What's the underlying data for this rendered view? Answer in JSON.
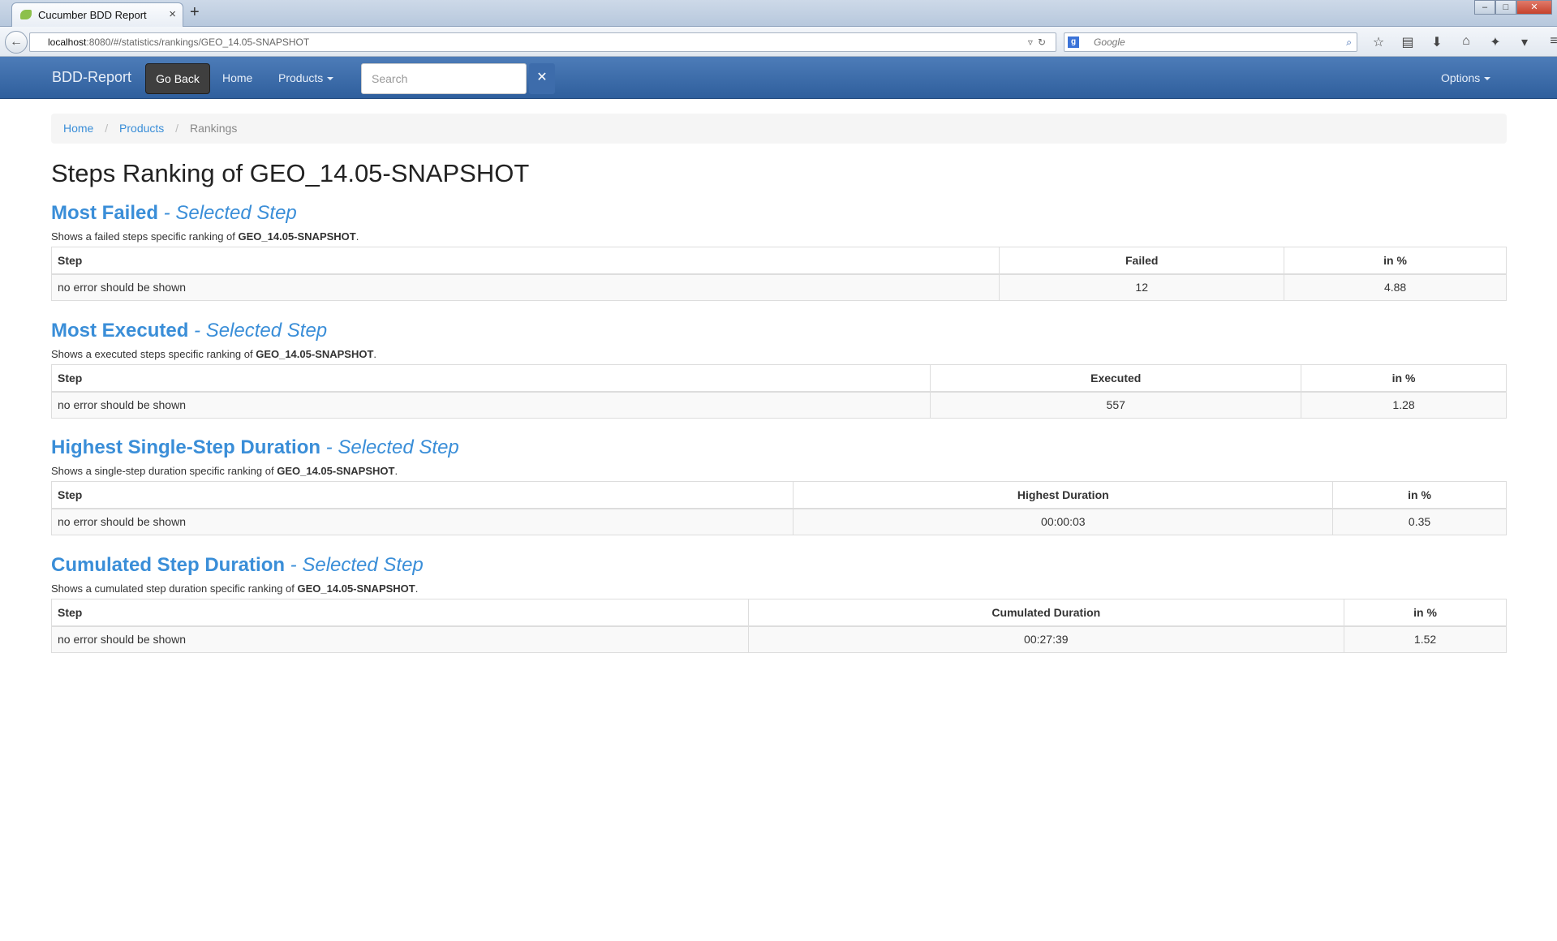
{
  "browser": {
    "tab_title": "Cucumber BDD Report",
    "url_host": "localhost",
    "url_rest": ":8080/#/statistics/rankings/GEO_14.05-SNAPSHOT",
    "search_engine_placeholder": "Google"
  },
  "navbar": {
    "brand": "BDD-Report",
    "go_back": "Go Back",
    "home": "Home",
    "products": "Products",
    "search_placeholder": "Search",
    "options": "Options"
  },
  "breadcrumb": {
    "home": "Home",
    "products": "Products",
    "current": "Rankings"
  },
  "page": {
    "title": "Steps Ranking of GEO_14.05-SNAPSHOT"
  },
  "sections": [
    {
      "heading": "Most Failed",
      "subheading": " - Selected Step",
      "desc_prefix": "Shows a failed steps specific ranking of ",
      "desc_product": "GEO_14.05-SNAPSHOT",
      "desc_suffix": ".",
      "columns": [
        "Step",
        "Failed",
        "in %"
      ],
      "row": [
        "no error should be shown",
        "12",
        "4.88"
      ]
    },
    {
      "heading": "Most Executed",
      "subheading": " - Selected Step",
      "desc_prefix": "Shows a executed steps specific ranking of ",
      "desc_product": "GEO_14.05-SNAPSHOT",
      "desc_suffix": ".",
      "columns": [
        "Step",
        "Executed",
        "in %"
      ],
      "row": [
        "no error should be shown",
        "557",
        "1.28"
      ]
    },
    {
      "heading": "Highest Single-Step Duration",
      "subheading": " - Selected Step",
      "desc_prefix": "Shows a single-step duration specific ranking of ",
      "desc_product": "GEO_14.05-SNAPSHOT",
      "desc_suffix": ".",
      "columns": [
        "Step",
        "Highest Duration",
        "in %"
      ],
      "row": [
        "no error should be shown",
        "00:00:03",
        "0.35"
      ]
    },
    {
      "heading": "Cumulated Step Duration",
      "subheading": " - Selected Step",
      "desc_prefix": "Shows a cumulated step duration specific ranking of ",
      "desc_product": "GEO_14.05-SNAPSHOT",
      "desc_suffix": ".",
      "columns": [
        "Step",
        "Cumulated Duration",
        "in %"
      ],
      "row": [
        "no error should be shown",
        "00:27:39",
        "1.52"
      ]
    }
  ]
}
